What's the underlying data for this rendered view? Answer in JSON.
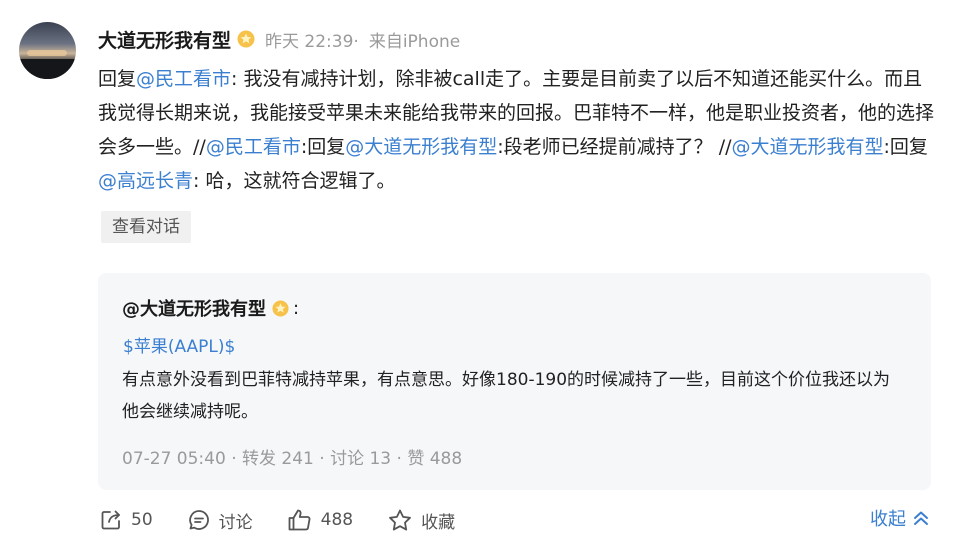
{
  "post": {
    "author": "大道无形我有型",
    "time": "昨天 22:39·",
    "source": "来自iPhone",
    "content": [
      {
        "t": "text",
        "v": "回复"
      },
      {
        "t": "mention",
        "v": "@民工看市"
      },
      {
        "t": "text",
        "v": ": 我没有减持计划，除非被call走了。主要是目前卖了以后不知道还能买什么。而且我觉得长期来说，我能接受苹果未来能给我带来的回报。巴菲特不一样，他是职业投资者，他的选择会多一些。//"
      },
      {
        "t": "mention",
        "v": "@民工看市"
      },
      {
        "t": "text",
        "v": ":回复"
      },
      {
        "t": "mention",
        "v": "@大道无形我有型"
      },
      {
        "t": "text",
        "v": ":段老师已经提前减持了？ //"
      },
      {
        "t": "mention",
        "v": "@大道无形我有型"
      },
      {
        "t": "text",
        "v": ":回复"
      },
      {
        "t": "mention",
        "v": "@高远长青"
      },
      {
        "t": "text",
        "v": ": 哈，这就符合逻辑了。"
      }
    ],
    "view_conversation": "查看对话"
  },
  "quote": {
    "author": "@大道无形我有型",
    "colon": ":",
    "tag": "$苹果(AAPL)$",
    "body": "有点意外没看到巴菲特减持苹果，有点意思。好像180-190的时候减持了一些，目前这个价位我还以为他会继续减持呢。",
    "stats": "07-27 05:40  · 转发 241 · 讨论 13 · 赞 488"
  },
  "actions": {
    "repost_count": "50",
    "comment_label": "讨论",
    "like_count": "488",
    "favorite_label": "收藏",
    "collapse_label": "收起"
  },
  "colors": {
    "link": "#3b7fd0",
    "meta": "#9a9a9a",
    "quote_bg": "#f6f7f9"
  }
}
